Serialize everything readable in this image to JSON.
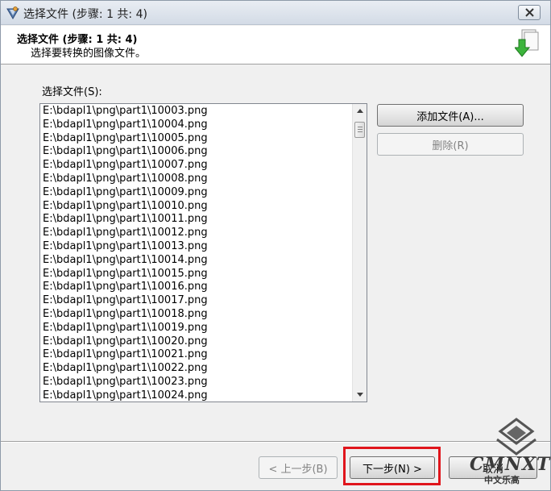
{
  "window": {
    "title": "选择文件 (步骤: 1 共: 4)"
  },
  "header": {
    "title": "选择文件 (步骤: 1 共: 4)",
    "subtitle": "选择要转换的图像文件。"
  },
  "file_list": {
    "label": "选择文件(S):",
    "items": [
      "E:\\bdapl1\\png\\part1\\10003.png",
      "E:\\bdapl1\\png\\part1\\10004.png",
      "E:\\bdapl1\\png\\part1\\10005.png",
      "E:\\bdapl1\\png\\part1\\10006.png",
      "E:\\bdapl1\\png\\part1\\10007.png",
      "E:\\bdapl1\\png\\part1\\10008.png",
      "E:\\bdapl1\\png\\part1\\10009.png",
      "E:\\bdapl1\\png\\part1\\10010.png",
      "E:\\bdapl1\\png\\part1\\10011.png",
      "E:\\bdapl1\\png\\part1\\10012.png",
      "E:\\bdapl1\\png\\part1\\10013.png",
      "E:\\bdapl1\\png\\part1\\10014.png",
      "E:\\bdapl1\\png\\part1\\10015.png",
      "E:\\bdapl1\\png\\part1\\10016.png",
      "E:\\bdapl1\\png\\part1\\10017.png",
      "E:\\bdapl1\\png\\part1\\10018.png",
      "E:\\bdapl1\\png\\part1\\10019.png",
      "E:\\bdapl1\\png\\part1\\10020.png",
      "E:\\bdapl1\\png\\part1\\10021.png",
      "E:\\bdapl1\\png\\part1\\10022.png",
      "E:\\bdapl1\\png\\part1\\10023.png",
      "E:\\bdapl1\\png\\part1\\10024.png"
    ]
  },
  "buttons": {
    "add_files": "添加文件(A)...",
    "delete": "删除(R)",
    "back": "< 上一步(B)",
    "next": "下一步(N) >",
    "cancel": "取消"
  },
  "watermark": {
    "text": "CMNXT",
    "sub": "中文乐高"
  },
  "colors": {
    "highlight": "#e0151c",
    "arrow_green": "#3cb43c"
  },
  "icons": {
    "app": "app-logo-icon",
    "close": "close-icon",
    "header": "document-download-icon",
    "scroll_up": "scroll-up-arrow-icon",
    "scroll_down": "scroll-down-arrow-icon"
  }
}
